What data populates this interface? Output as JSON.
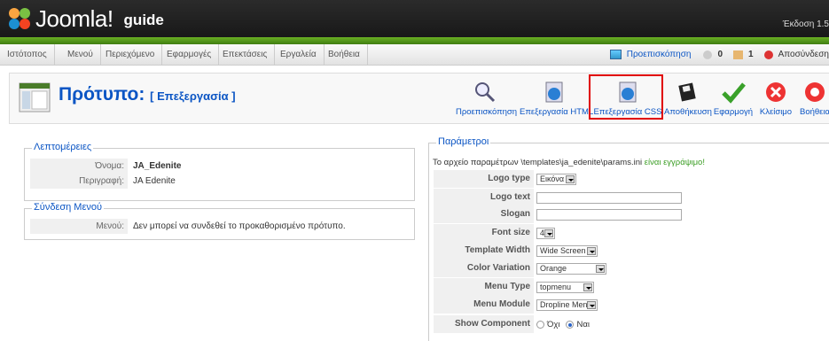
{
  "header": {
    "brand": "Joomla!",
    "site": "guide",
    "version": "Έκδοση 1.5"
  },
  "menu": {
    "items": [
      "Ιστότοπος",
      "Μενού",
      "Περιεχόμενο",
      "Εφαρμογές",
      "Επεκτάσεις",
      "Εργαλεία",
      "Βοήθεια"
    ],
    "preview": "Προεπισκόπηση",
    "messages": "0",
    "users": "1",
    "logout": "Αποσύνδεση"
  },
  "page": {
    "title": "Πρότυπο:",
    "subtitle": "[ Επεξεργασία ]"
  },
  "toolbar": {
    "buttons": [
      "Προεπισκόπηση",
      "Επεξεργασία HTML",
      "Επεξεργασία CSS",
      "Αποθήκευση",
      "Εφαρμογή",
      "Κλείσιμο",
      "Βοήθεια"
    ]
  },
  "details": {
    "legend": "Λεπτομέρειες",
    "name_label": "Όνομα:",
    "name_value": "JA_Edenite",
    "desc_label": "Περιγραφή:",
    "desc_value": "JA Edenite"
  },
  "menulink": {
    "legend": "Σύνδεση Μενού",
    "label": "Μενού:",
    "value": "Δεν μπορεί να συνδεθεί το προκαθορισμένο πρότυπο."
  },
  "params": {
    "legend": "Παράμετροι",
    "note": "Το αρχείο παραμέτρων \\templates\\ja_edenite\\params.ini",
    "writable": "είναι εγγράψιμο!",
    "logo_type_label": "Logo type",
    "logo_type": "Εικόνα",
    "logo_text_label": "Logo text",
    "slogan_label": "Slogan",
    "font_size_label": "Font size",
    "font_size": "4",
    "width_label": "Template Width",
    "width": "Wide Screen",
    "color_label": "Color Variation",
    "color": "Orange",
    "menu_type_label": "Menu Type",
    "menu_type": "topmenu",
    "menu_module_label": "Menu Module",
    "menu_module": "Dropline Menu",
    "show_comp_label": "Show Component",
    "no": "Όχι",
    "yes": "Ναι"
  },
  "colors": {
    "accent": "#0b55c4",
    "green": "#6ab023",
    "highlight": "#e00000"
  }
}
